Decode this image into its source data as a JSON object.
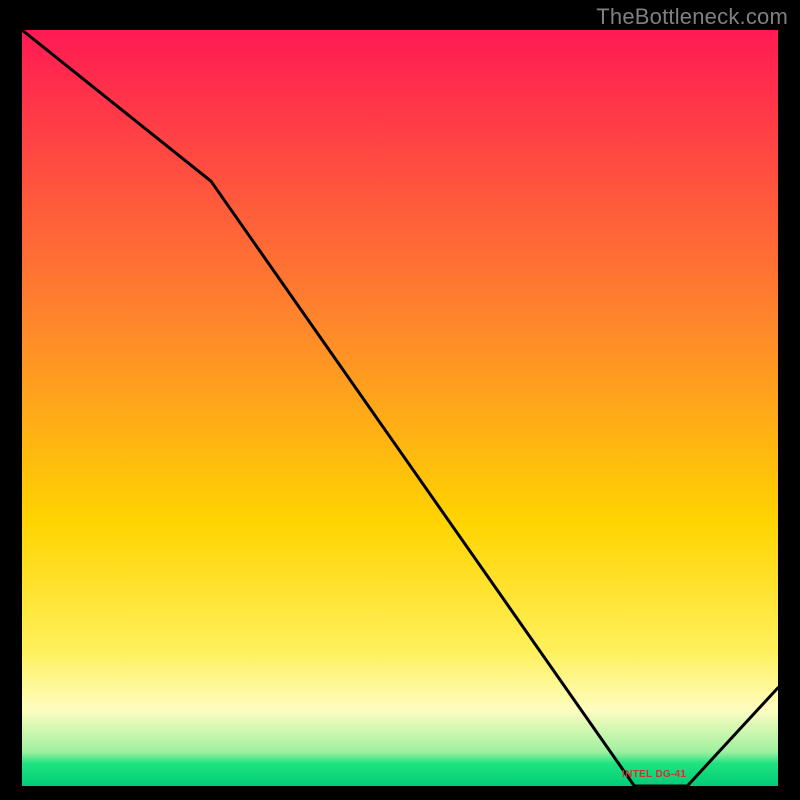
{
  "watermark": "TheBottleneck.com",
  "label_text": "INTEL DG-41",
  "chart_data": {
    "type": "line",
    "title": "",
    "xlabel": "",
    "ylabel": "",
    "xlim": [
      0,
      100
    ],
    "ylim": [
      0,
      100
    ],
    "x": [
      0,
      25,
      81,
      88,
      100
    ],
    "values": [
      100,
      80,
      0,
      0,
      13
    ],
    "gradient_stops": [
      {
        "pct": 0.0,
        "color": "#ff1a53"
      },
      {
        "pct": 0.4,
        "color": "#ff8a2a"
      },
      {
        "pct": 0.65,
        "color": "#ffd400"
      },
      {
        "pct": 0.82,
        "color": "#fff05a"
      },
      {
        "pct": 0.9,
        "color": "#fdfdc0"
      },
      {
        "pct": 0.955,
        "color": "#9ff0a0"
      },
      {
        "pct": 0.97,
        "color": "#20e380"
      },
      {
        "pct": 1.0,
        "color": "#00cc77"
      }
    ],
    "annotation": {
      "text_key": "label_text",
      "x": 84,
      "y": 1.5
    }
  }
}
